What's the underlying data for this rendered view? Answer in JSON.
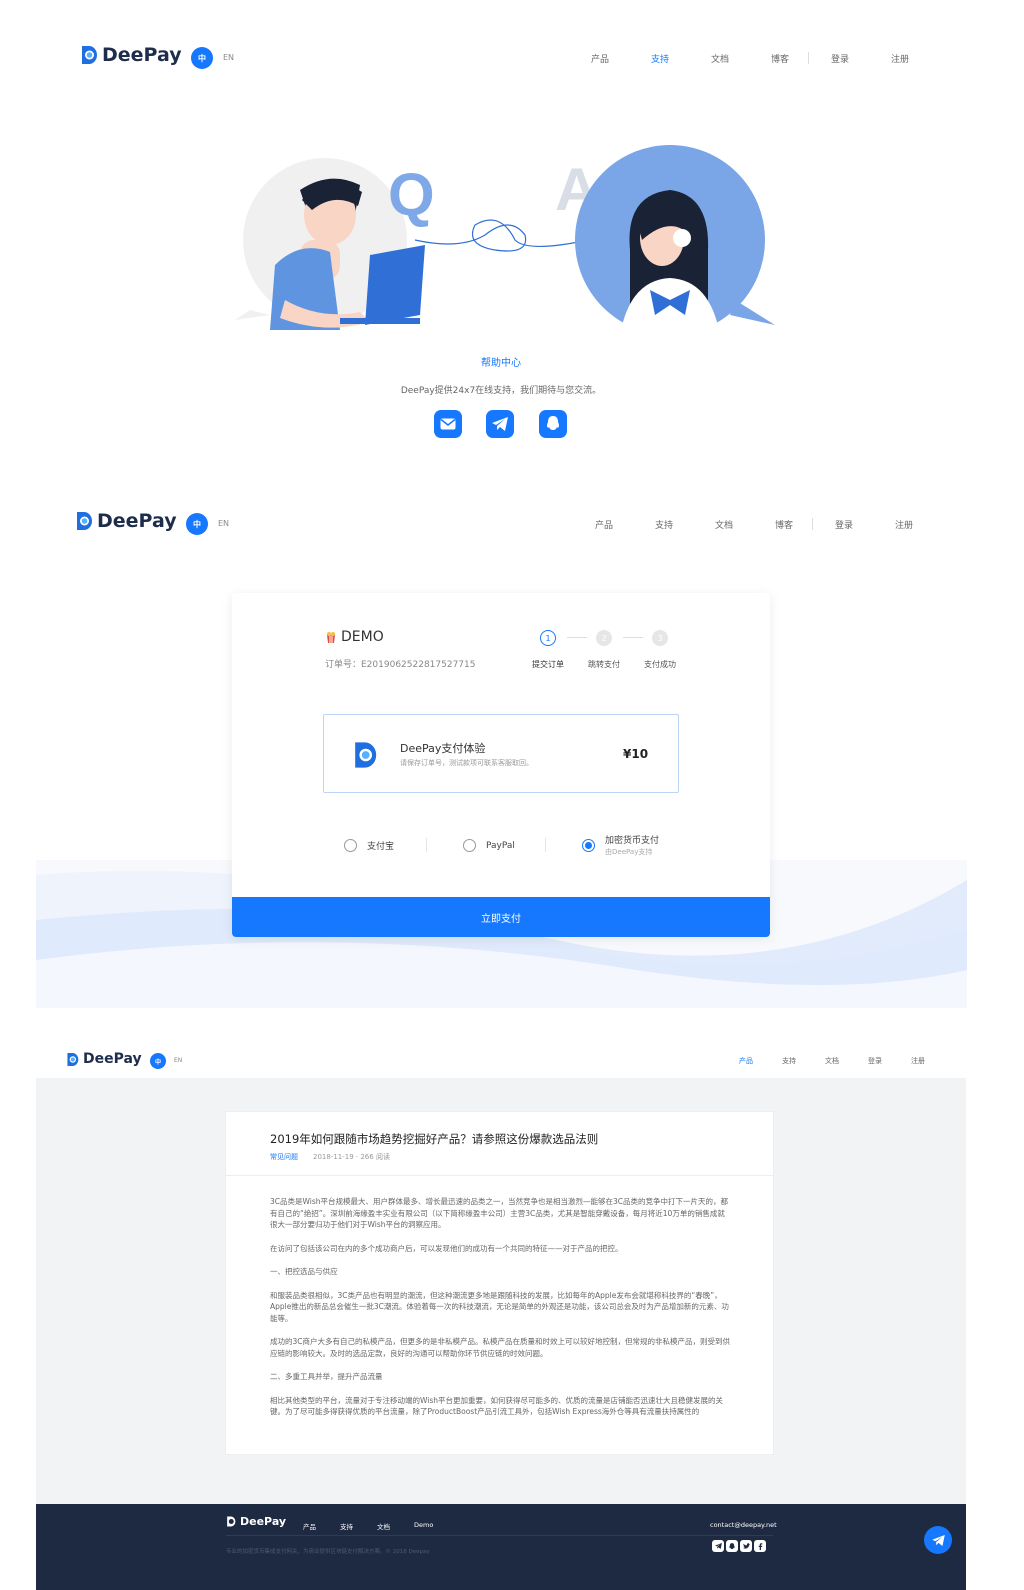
{
  "brand": {
    "name": "DeePay",
    "lang_zh": "中",
    "lang_en": "EN"
  },
  "nav": [
    "产品",
    "支持",
    "文档",
    "博客",
    "登录",
    "注册"
  ],
  "support": {
    "title": "帮助中心",
    "desc": "DeePay提供24x7在线支持，我们期待与您交流。",
    "icons": [
      "mail-icon",
      "telegram-icon",
      "qq-icon"
    ]
  },
  "checkout": {
    "shop": "DEMO",
    "order_no": "订单号：E2019062522817527715",
    "steps": [
      {
        "num": "1",
        "label": "提交订单"
      },
      {
        "num": "2",
        "label": "跳转支付"
      },
      {
        "num": "3",
        "label": "支付成功"
      }
    ],
    "product_name": "DeePay支付体验",
    "product_note": "请保存订单号，测试款项可联系客服取回。",
    "price": "¥10",
    "methods": [
      {
        "label": "支付宝",
        "sub": "",
        "selected": false
      },
      {
        "label": "PayPal",
        "sub": "",
        "selected": false
      },
      {
        "label": "加密货币支付",
        "sub": "由DeePay支持",
        "selected": true
      }
    ],
    "pay_button": "立即支付"
  },
  "article": {
    "title": "2019年如何跟随市场趋势挖掘好产品？请参照这份爆款选品法则",
    "category": "常见问题",
    "meta": "2018-11-19 · 266 阅读",
    "paragraphs": [
      "3C品类是Wish平台规模最大、用户群体最多、增长最迅速的品类之一，当然竞争也是相当激烈—能够在3C品类的竞争中打下一片天的，都有自己的“绝招”。深圳前海缘盈丰实业有限公司（以下简称缘盈丰公司）主营3C品类，尤其是智能穿戴设备，每月将近10万单的销售成就很大一部分要归功于他们对于Wish平台的洞察应用。",
      "在访问了包括该公司在内的多个成功商户后，可以发现他们的成功有一个共同的特征——对于产品的把控。",
      "一、把控选品与供应",
      "和服装品类很相似，3C类产品也有明显的潮流，但这种潮流更多地是跟随科技的发展，比如每年的Apple发布会就堪称科技界的“春晚”，Apple推出的新品总会催生一批3C潮流。体验着每一次的科技潮流，无论是简单的外观还是功能，该公司总会及时为产品增加新的元素、功能等。",
      "成功的3C商户大多有自己的私模产品，但更多的是非私模产品。私模产品在质量和时效上可以较好地控制，但常规的非私模产品，则受到供应链的影响较大。及时的选品定款，良好的沟通可以帮助你环节供应链的时效问题。",
      "二、多重工具并举，提升产品流量",
      "相比其他类型的平台，流量对于专注移动端的Wish平台更加重要，如何获得尽可能多的、优质的流量是店铺能否迅速壮大且稳健发展的关键。为了尽可能多得获得优质的平台流量，除了ProductBoost产品引流工具外，包括Wish Express海外仓等具有流量扶持属性的"
    ]
  },
  "footer": {
    "links": [
      "产品",
      "支持",
      "文档",
      "Demo"
    ],
    "email": "contact@deepay.net",
    "copyright": "专业的加密货币集成支付网关，为商业提供区块链支付解决方案。© 2018 Deepay"
  },
  "colors": {
    "primary": "#1677ff",
    "footer_bg": "#1e2a42",
    "light_blue": "#6f9ee6"
  }
}
